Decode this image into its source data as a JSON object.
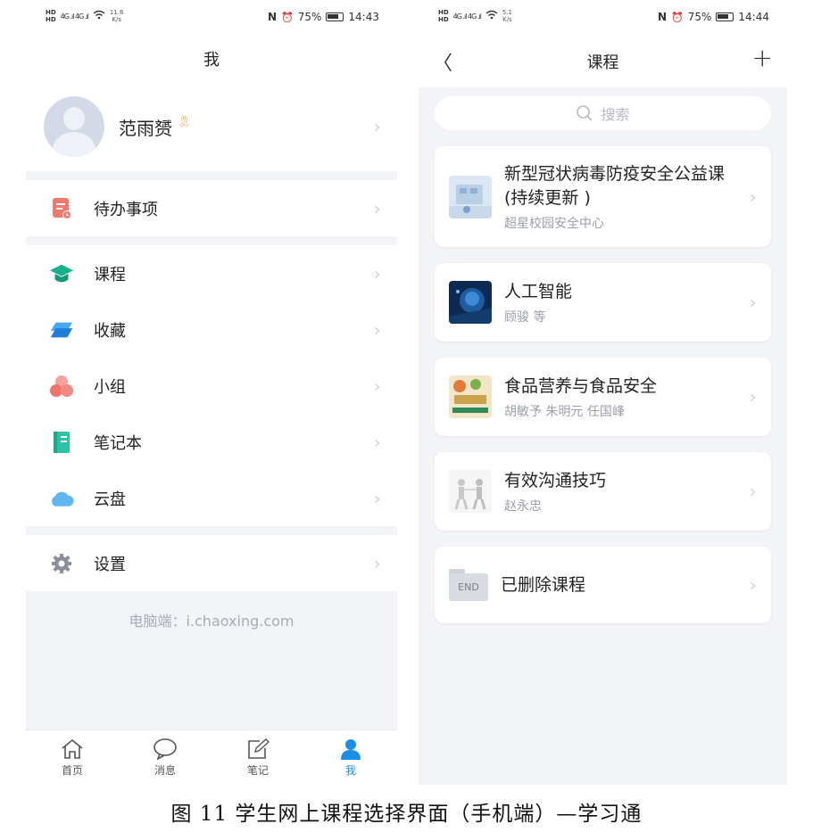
{
  "left_screen": {
    "status": {
      "hd": [
        "HD",
        "HD"
      ],
      "signal": "4G .ıl 4G .ıl",
      "speed_value": "11.6",
      "speed_unit": "K/s",
      "nfc": "N",
      "alarm": "⏰",
      "battery": "75%",
      "time": "14:43"
    },
    "nav": {
      "title": "我"
    },
    "profile": {
      "name": "范雨赟",
      "badge": "🎗"
    },
    "todo": {
      "label": "待办事项"
    },
    "menu": [
      {
        "id": "courses",
        "label": "课程",
        "icon_color": "#17b28d"
      },
      {
        "id": "favorites",
        "label": "收藏",
        "icon_color": "#2b8fe0"
      },
      {
        "id": "group",
        "label": "小组",
        "icon_color": "#f07a6e"
      },
      {
        "id": "notebook",
        "label": "笔记本",
        "icon_color": "#2ec3a5"
      },
      {
        "id": "cloud",
        "label": "云盘",
        "icon_color": "#5fb6f0"
      }
    ],
    "settings": {
      "label": "设置"
    },
    "pc_hint": "电脑端：i.chaoxing.com",
    "tabs": [
      {
        "id": "home",
        "label": "首页"
      },
      {
        "id": "messages",
        "label": "消息"
      },
      {
        "id": "notes",
        "label": "笔记"
      },
      {
        "id": "me",
        "label": "我"
      }
    ],
    "chevron": "›"
  },
  "right_screen": {
    "status": {
      "hd": [
        "HD",
        "HD"
      ],
      "signal": "4G .ıl 4G .ıl",
      "speed_value": "5.1",
      "speed_unit": "K/s",
      "nfc": "N",
      "alarm": "⏰",
      "battery": "75%",
      "time": "14:44"
    },
    "nav": {
      "title": "课程",
      "back": "〈",
      "add": "+"
    },
    "search_placeholder": "搜索",
    "courses": [
      {
        "title": "新型冠状病毒防疫安全公益课(持续更新 )",
        "subtitle": "超星校园安全中心"
      },
      {
        "title": "人工智能",
        "subtitle": "顾骏 等"
      },
      {
        "title": "食品营养与食品安全",
        "subtitle": "胡敏予 朱明元 任国峰"
      },
      {
        "title": "有效沟通技巧",
        "subtitle": "赵永忠"
      }
    ],
    "deleted": {
      "label": "已删除课程",
      "folder_text": "END"
    },
    "chevron": "›"
  },
  "caption": "图 11  学生网上课程选择界面（手机端）—学习通"
}
